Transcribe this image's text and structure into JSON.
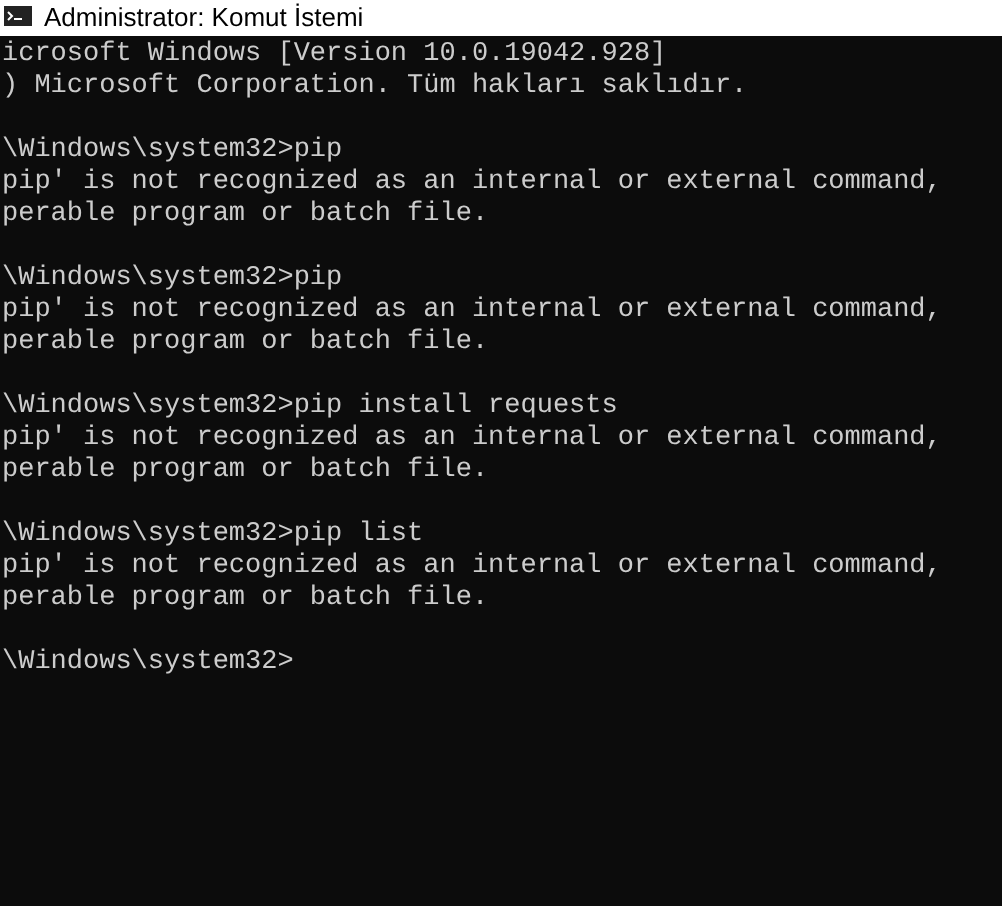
{
  "window": {
    "title": "Administrator: Komut İstemi"
  },
  "console": {
    "blocks": [
      [
        "icrosoft Windows [Version 10.0.19042.928]",
        ") Microsoft Corporation. Tüm hakları saklıdır."
      ],
      [
        "\\Windows\\system32>pip",
        "pip' is not recognized as an internal or external command,",
        "perable program or batch file."
      ],
      [
        "\\Windows\\system32>pip",
        "pip' is not recognized as an internal or external command,",
        "perable program or batch file."
      ],
      [
        "\\Windows\\system32>pip install requests",
        "pip' is not recognized as an internal or external command,",
        "perable program or batch file."
      ],
      [
        "\\Windows\\system32>pip list",
        "pip' is not recognized as an internal or external command,",
        "perable program or batch file."
      ],
      [
        "\\Windows\\system32>"
      ]
    ]
  }
}
